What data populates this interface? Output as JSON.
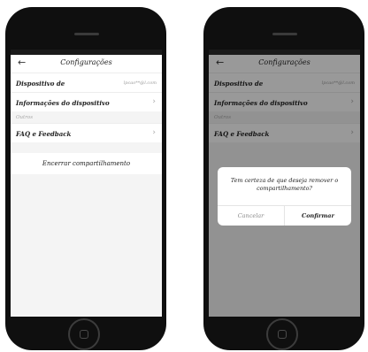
{
  "screens": {
    "settings": {
      "title": "Configurações",
      "device_label": "Dispositivo de",
      "device_value": "lpcao**@l.com",
      "device_info_label": "Informações do dispositivo",
      "others_section": "Outros",
      "faq_label": "FAQ e Feedback",
      "end_sharing_label": "Encerrar compartilhamento"
    },
    "confirm": {
      "title": "Configurações",
      "device_label": "Dispositivo de",
      "device_value": "lpcao**@l.com",
      "device_info_label": "Informações do dispositivo",
      "others_section": "Outros",
      "faq_label": "FAQ e Feedback",
      "dialog": {
        "message": "Tem certeza de que deseja remover o compartilhamento?",
        "cancel_label": "Cancelar",
        "confirm_label": "Confirmar"
      }
    }
  },
  "icons": {
    "back": "arrow-left-icon",
    "chevron": "chevron-right-icon",
    "home": "home-button-icon"
  },
  "colors": {
    "phone_body": "#0f0f0f",
    "screen_bg": "#f4f4f4",
    "overlay": "rgba(0,0,0,0.40)"
  }
}
